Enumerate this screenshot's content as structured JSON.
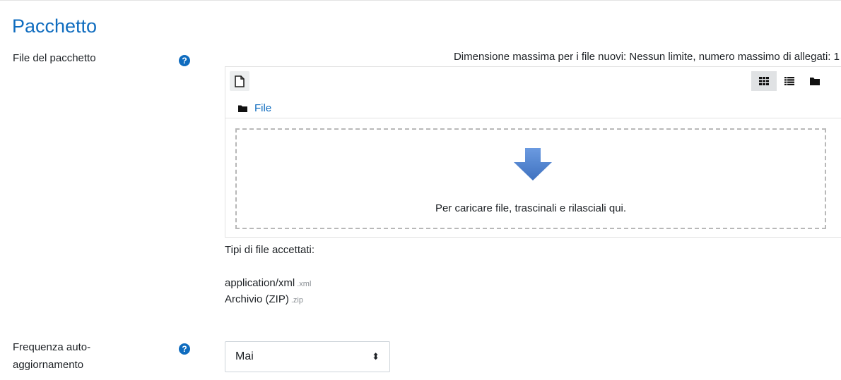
{
  "section": {
    "title": "Pacchetto"
  },
  "package_field": {
    "label": "File del pacchetto",
    "help_icon": "question-circle-icon",
    "limits_text": "Dimensione massima per i file nuovi: Nessun limite, numero massimo di allegati: 1",
    "toolbar": {
      "add_icon": "file-add-icon",
      "views": [
        {
          "icon": "grid-view-icon",
          "active": true
        },
        {
          "icon": "list-view-icon",
          "active": false
        },
        {
          "icon": "folder-view-icon",
          "active": false
        }
      ]
    },
    "path": {
      "icon": "folder-icon",
      "label": "File"
    },
    "dropzone_text": "Per caricare file, trascinali e rilasciali qui.",
    "accepted_title": "Tipi di file accettati:",
    "accepted_types": [
      {
        "name": "application/xml",
        "ext": ".xml"
      },
      {
        "name": "Archivio (ZIP)",
        "ext": ".zip"
      }
    ]
  },
  "auto_update": {
    "label_line1": "Frequenza auto-",
    "label_line2": "aggiornamento",
    "help_icon": "question-circle-icon",
    "selected": "Mai"
  },
  "colors": {
    "accent": "#0f6cbf",
    "drop_arrow": "#4a7cc4"
  }
}
